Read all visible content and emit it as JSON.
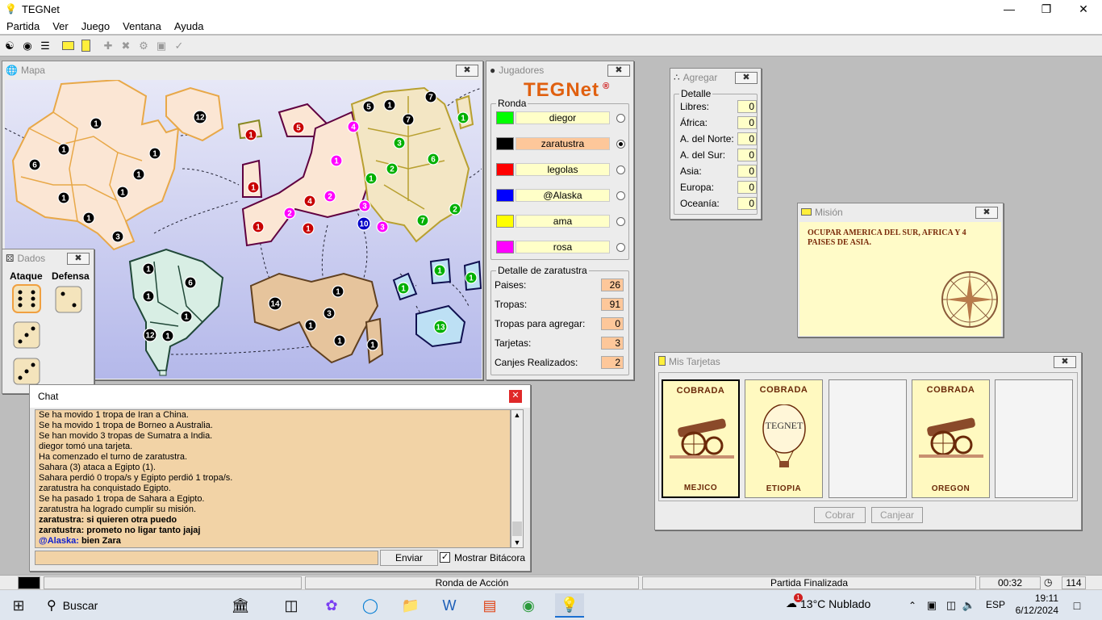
{
  "app": {
    "title": "TEGNet"
  },
  "menu": [
    "Partida",
    "Ver",
    "Juego",
    "Ventana",
    "Ayuda"
  ],
  "map": {
    "title": "Mapa",
    "armies": [
      {
        "n": "1",
        "c": "black"
      },
      {
        "n": "6",
        "c": "black"
      },
      {
        "n": "1",
        "c": "black"
      },
      {
        "n": "1",
        "c": "black"
      },
      {
        "n": "1",
        "c": "black"
      },
      {
        "n": "1",
        "c": "black"
      },
      {
        "n": "1",
        "c": "black"
      },
      {
        "n": "1",
        "c": "black"
      },
      {
        "n": "3",
        "c": "black"
      },
      {
        "n": "12",
        "c": "black"
      },
      {
        "n": "1",
        "c": "red"
      },
      {
        "n": "5",
        "c": "red"
      },
      {
        "n": "1",
        "c": "red"
      },
      {
        "n": "1",
        "c": "red"
      },
      {
        "n": "4",
        "c": "red"
      },
      {
        "n": "1",
        "c": "red"
      },
      {
        "n": "4",
        "c": "magenta"
      },
      {
        "n": "1",
        "c": "magenta"
      },
      {
        "n": "2",
        "c": "magenta"
      },
      {
        "n": "2",
        "c": "magenta"
      },
      {
        "n": "3",
        "c": "magenta"
      },
      {
        "n": "3",
        "c": "magenta"
      },
      {
        "n": "10",
        "c": "blue"
      },
      {
        "n": "5",
        "c": "black"
      },
      {
        "n": "1",
        "c": "black"
      },
      {
        "n": "7",
        "c": "black"
      },
      {
        "n": "7",
        "c": "black"
      },
      {
        "n": "3",
        "c": "green"
      },
      {
        "n": "2",
        "c": "green"
      },
      {
        "n": "6",
        "c": "green"
      },
      {
        "n": "1",
        "c": "green"
      },
      {
        "n": "1",
        "c": "green"
      },
      {
        "n": "2",
        "c": "green"
      },
      {
        "n": "7",
        "c": "green"
      },
      {
        "n": "1",
        "c": "green"
      },
      {
        "n": "1",
        "c": "green"
      },
      {
        "n": "1",
        "c": "green"
      },
      {
        "n": "13",
        "c": "green"
      },
      {
        "n": "1",
        "c": "black"
      },
      {
        "n": "6",
        "c": "black"
      },
      {
        "n": "1",
        "c": "black"
      },
      {
        "n": "1",
        "c": "black"
      },
      {
        "n": "12",
        "c": "black"
      },
      {
        "n": "1",
        "c": "black"
      },
      {
        "n": "14",
        "c": "black"
      },
      {
        "n": "1",
        "c": "black"
      },
      {
        "n": "3",
        "c": "black"
      },
      {
        "n": "1",
        "c": "black"
      },
      {
        "n": "1",
        "c": "black"
      },
      {
        "n": "1",
        "c": "black"
      }
    ]
  },
  "jugadores": {
    "title": "Jugadores",
    "logo": "TEGNet",
    "ronda_label": "Ronda",
    "players": [
      {
        "name": "diegor",
        "color": "#00ff00",
        "active": false
      },
      {
        "name": "zaratustra",
        "color": "#000000",
        "active": true
      },
      {
        "name": "legolas",
        "color": "#ff0000",
        "active": false
      },
      {
        "name": "@Alaska",
        "color": "#0000ff",
        "active": false
      },
      {
        "name": "ama",
        "color": "#ffff00",
        "active": false
      },
      {
        "name": "rosa",
        "color": "#ff00ff",
        "active": false
      }
    ],
    "detalle_label": "Detalle de zaratustra",
    "detalle": [
      {
        "label": "Paises:",
        "value": "26"
      },
      {
        "label": "Tropas:",
        "value": "91"
      },
      {
        "label": "Tropas para agregar:",
        "value": "0"
      },
      {
        "label": "Tarjetas:",
        "value": "3"
      },
      {
        "label": "Canjes Realizados:",
        "value": "2"
      }
    ]
  },
  "agregar": {
    "title": "Agregar",
    "detalle_label": "Detalle",
    "rows": [
      {
        "label": "Libres:",
        "value": "0"
      },
      {
        "label": "África:",
        "value": "0"
      },
      {
        "label": "A. del Norte:",
        "value": "0"
      },
      {
        "label": "A. del Sur:",
        "value": "0"
      },
      {
        "label": "Asia:",
        "value": "0"
      },
      {
        "label": "Europa:",
        "value": "0"
      },
      {
        "label": "Oceanía:",
        "value": "0"
      }
    ]
  },
  "mision": {
    "title": "Misión",
    "text": "OCUPAR AMERICA DEL SUR, AFRICA Y 4 PAISES DE ASIA."
  },
  "tarjetas": {
    "title": "Mis Tarjetas",
    "cards": [
      {
        "top": "COBRADA",
        "bottom": "MEJICO",
        "icon": "cannon-icon"
      },
      {
        "top": "COBRADA",
        "bottom": "ETIOPIA",
        "icon": "balloon-icon",
        "balloon_text": "TEGNET"
      },
      {
        "top": "",
        "bottom": "",
        "icon": ""
      },
      {
        "top": "COBRADA",
        "bottom": "OREGON",
        "icon": "cannon-icon"
      },
      {
        "top": "",
        "bottom": "",
        "icon": ""
      }
    ],
    "cobrar": "Cobrar",
    "canjear": "Canjear"
  },
  "dados": {
    "title": "Dados",
    "ataque": "Ataque",
    "defensa": "Defensa"
  },
  "chat": {
    "title": "Chat",
    "lines": [
      {
        "t": "Se ha movido 1 tropa de Iran a China.",
        "b": false
      },
      {
        "t": "Se ha movido 1 tropa de Borneo a Australia.",
        "b": false
      },
      {
        "t": "Se han movido 3 tropas de Sumatra a India.",
        "b": false
      },
      {
        "t": "diegor tomó una tarjeta.",
        "b": false
      },
      {
        "t": "Ha comenzado el turno de zaratustra.",
        "b": false
      },
      {
        "t": "Sahara (3) ataca a Egipto (1).",
        "b": false
      },
      {
        "t": "Sahara perdió 0 tropa/s y Egipto perdió 1 tropa/s.",
        "b": false
      },
      {
        "t": "zaratustra ha conquistado Egipto.",
        "b": false
      },
      {
        "t": "Se ha pasado 1 tropa de Sahara a Egipto.",
        "b": false
      },
      {
        "t": "zaratustra ha logrado cumplir su misión.",
        "b": false
      },
      {
        "t": "zaratustra: si quieren otra puedo",
        "b": true
      },
      {
        "t": "zaratustra: prometo no ligar tanto jajaj",
        "b": true
      },
      {
        "t": "bien Zara",
        "b": true,
        "who": "@Alaska:"
      }
    ],
    "enviar": "Enviar",
    "mostrar": "Mostrar Bitácora"
  },
  "status": {
    "ronda": "Ronda de Acción",
    "partida": "Partida Finalizada",
    "time": "00:32",
    "count": "114"
  },
  "taskbar": {
    "search": "Buscar",
    "weather": "13°C  Nublado",
    "lang": "ESP",
    "clock": "19:11",
    "date": "6/12/2024",
    "weather_badge": "1"
  }
}
